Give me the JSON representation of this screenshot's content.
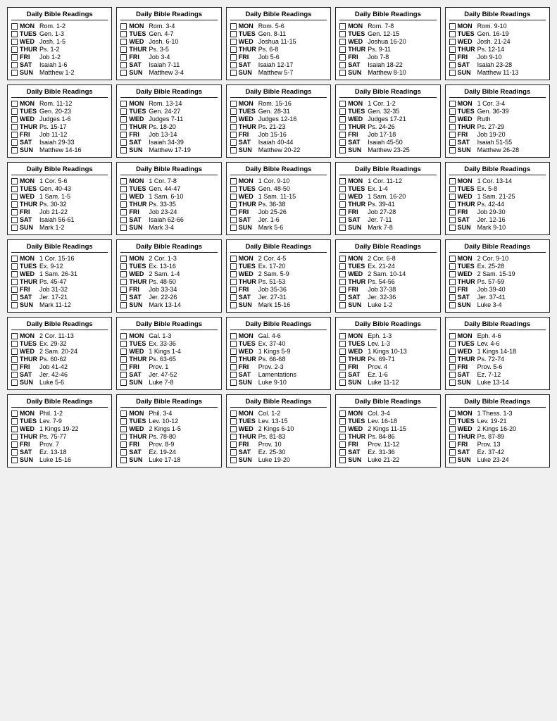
{
  "cards": [
    {
      "title": "Daily Bible Readings",
      "readings": [
        {
          "day": "MON",
          "passage": "Rom. 1-2"
        },
        {
          "day": "TUES",
          "passage": "Gen. 1-3"
        },
        {
          "day": "WED",
          "passage": "Josh. 1-5"
        },
        {
          "day": "THUR",
          "passage": "Ps. 1-2"
        },
        {
          "day": "FRI",
          "passage": "Job 1-2"
        },
        {
          "day": "SAT",
          "passage": "Isaiah 1-6"
        },
        {
          "day": "SUN",
          "passage": "Matthew 1-2"
        }
      ]
    },
    {
      "title": "Daily Bible Readings",
      "readings": [
        {
          "day": "MON",
          "passage": "Rom. 3-4"
        },
        {
          "day": "TUES",
          "passage": "Gen. 4-7"
        },
        {
          "day": "WED",
          "passage": "Josh. 6-10"
        },
        {
          "day": "THUR",
          "passage": "Ps. 3-5"
        },
        {
          "day": "FRI",
          "passage": "Job 3-4"
        },
        {
          "day": "SAT",
          "passage": "Isaiah 7-11"
        },
        {
          "day": "SUN",
          "passage": "Matthew 3-4"
        }
      ]
    },
    {
      "title": "Daily Bible Readings",
      "readings": [
        {
          "day": "MON",
          "passage": "Rom. 5-6"
        },
        {
          "day": "TUES",
          "passage": "Gen. 8-11"
        },
        {
          "day": "WED",
          "passage": "Joshua 11-15"
        },
        {
          "day": "THUR",
          "passage": "Ps. 6-8"
        },
        {
          "day": "FRI",
          "passage": "Job 5-6"
        },
        {
          "day": "SAT",
          "passage": "Isaiah 12-17"
        },
        {
          "day": "SUN",
          "passage": "Matthew 5-7"
        }
      ]
    },
    {
      "title": "Daily Bible Readings",
      "readings": [
        {
          "day": "MON",
          "passage": "Rom. 7-8"
        },
        {
          "day": "TUES",
          "passage": "Gen. 12-15"
        },
        {
          "day": "WED",
          "passage": "Joshua 16-20"
        },
        {
          "day": "THUR",
          "passage": "Ps. 9-11"
        },
        {
          "day": "FRI",
          "passage": "Job 7-8"
        },
        {
          "day": "SAT",
          "passage": "Isaiah 18-22"
        },
        {
          "day": "SUN",
          "passage": "Matthew 8-10"
        }
      ]
    },
    {
      "title": "Daily Bible Readings",
      "readings": [
        {
          "day": "MON",
          "passage": "Rom. 9-10"
        },
        {
          "day": "TUES",
          "passage": "Gen. 16-19"
        },
        {
          "day": "WED",
          "passage": "Josh. 21-24"
        },
        {
          "day": "THUR",
          "passage": "Ps. 12-14"
        },
        {
          "day": "FRI",
          "passage": "Job 9-10"
        },
        {
          "day": "SAT",
          "passage": "Isaiah 23-28"
        },
        {
          "day": "SUN",
          "passage": "Matthew 11-13"
        }
      ]
    },
    {
      "title": "Daily Bible Readings",
      "readings": [
        {
          "day": "MON",
          "passage": "Rom. 11-12"
        },
        {
          "day": "TUES",
          "passage": "Gen. 20-23"
        },
        {
          "day": "WED",
          "passage": "Judges 1-6"
        },
        {
          "day": "THUR",
          "passage": "Ps. 15-17"
        },
        {
          "day": "FRI",
          "passage": "Job 11-12"
        },
        {
          "day": "SAT",
          "passage": "Isaiah 29-33"
        },
        {
          "day": "SUN",
          "passage": "Matthew 14-16"
        }
      ]
    },
    {
      "title": "Daily Bible Readings",
      "readings": [
        {
          "day": "MON",
          "passage": "Rom. 13-14"
        },
        {
          "day": "TUES",
          "passage": "Gen. 24-27"
        },
        {
          "day": "WED",
          "passage": "Judges 7-11"
        },
        {
          "day": "THUR",
          "passage": "Ps. 18-20"
        },
        {
          "day": "FRI",
          "passage": "Job 13-14"
        },
        {
          "day": "SAT",
          "passage": "Isaiah 34-39"
        },
        {
          "day": "SUN",
          "passage": "Matthew 17-19"
        }
      ]
    },
    {
      "title": "Daily Bible Readings",
      "readings": [
        {
          "day": "MON",
          "passage": "Rom. 15-16"
        },
        {
          "day": "TUES",
          "passage": "Gen. 28-31"
        },
        {
          "day": "WED",
          "passage": "Judges 12-16"
        },
        {
          "day": "THUR",
          "passage": "Ps. 21-23"
        },
        {
          "day": "FRI",
          "passage": "Job 15-16"
        },
        {
          "day": "SAT",
          "passage": "Isaiah 40-44"
        },
        {
          "day": "SUN",
          "passage": "Matthew 20-22"
        }
      ]
    },
    {
      "title": "Daily Bible Readings",
      "readings": [
        {
          "day": "MON",
          "passage": "1 Cor. 1-2"
        },
        {
          "day": "TUES",
          "passage": "Gen. 32-35"
        },
        {
          "day": "WED",
          "passage": "Judges 17-21"
        },
        {
          "day": "THUR",
          "passage": "Ps. 24-26"
        },
        {
          "day": "FRI",
          "passage": "Job 17-18"
        },
        {
          "day": "SAT",
          "passage": "Isaiah 45-50"
        },
        {
          "day": "SUN",
          "passage": "Matthew 23-25"
        }
      ]
    },
    {
      "title": "Daily Bible Readings",
      "readings": [
        {
          "day": "MON",
          "passage": "1 Cor. 3-4"
        },
        {
          "day": "TUES",
          "passage": "Gen. 36-39"
        },
        {
          "day": "WED",
          "passage": "Ruth"
        },
        {
          "day": "THUR",
          "passage": "Ps. 27-29"
        },
        {
          "day": "FRI",
          "passage": "Job 19-20"
        },
        {
          "day": "SAT",
          "passage": "Isaiah 51-55"
        },
        {
          "day": "SUN",
          "passage": "Matthew 26-28"
        }
      ]
    },
    {
      "title": "Daily Bible Readings",
      "readings": [
        {
          "day": "MON",
          "passage": "1 Cor. 5-6"
        },
        {
          "day": "TUES",
          "passage": "Gen. 40-43"
        },
        {
          "day": "WED",
          "passage": "1 Sam. 1-5"
        },
        {
          "day": "THUR",
          "passage": "Ps. 30-32"
        },
        {
          "day": "FRI",
          "passage": "Job 21-22"
        },
        {
          "day": "SAT",
          "passage": "Isaiah 56-61"
        },
        {
          "day": "SUN",
          "passage": "Mark 1-2"
        }
      ]
    },
    {
      "title": "Daily Bible Readings",
      "readings": [
        {
          "day": "MON",
          "passage": "1 Cor. 7-8"
        },
        {
          "day": "TUES",
          "passage": "Gen. 44-47"
        },
        {
          "day": "WED",
          "passage": "1 Sam. 6-10"
        },
        {
          "day": "THUR",
          "passage": "Ps. 33-35"
        },
        {
          "day": "FRI",
          "passage": "Job 23-24"
        },
        {
          "day": "SAT",
          "passage": "Isaiah 62-66"
        },
        {
          "day": "SUN",
          "passage": "Mark 3-4"
        }
      ]
    },
    {
      "title": "Daily Bible Readings",
      "readings": [
        {
          "day": "MON",
          "passage": "1 Cor. 9-10"
        },
        {
          "day": "TUES",
          "passage": "Gen. 48-50"
        },
        {
          "day": "WED",
          "passage": "1 Sam. 11-15"
        },
        {
          "day": "THUR",
          "passage": "Ps. 36-38"
        },
        {
          "day": "FRI",
          "passage": "Job 25-26"
        },
        {
          "day": "SAT",
          "passage": "Jer. 1-6"
        },
        {
          "day": "SUN",
          "passage": "Mark 5-6"
        }
      ]
    },
    {
      "title": "Daily Bible Readings",
      "readings": [
        {
          "day": "MON",
          "passage": "1 Cor. 11-12"
        },
        {
          "day": "TUES",
          "passage": "Ex. 1-4"
        },
        {
          "day": "WED",
          "passage": "1 Sam. 16-20"
        },
        {
          "day": "THUR",
          "passage": "Ps. 39-41"
        },
        {
          "day": "FRI",
          "passage": "Job 27-28"
        },
        {
          "day": "SAT",
          "passage": "Jer. 7-11"
        },
        {
          "day": "SUN",
          "passage": "Mark 7-8"
        }
      ]
    },
    {
      "title": "Daily Bible Readings",
      "readings": [
        {
          "day": "MON",
          "passage": "1 Cor. 13-14"
        },
        {
          "day": "TUES",
          "passage": "Ex. 5-8"
        },
        {
          "day": "WED",
          "passage": "1 Sam. 21-25"
        },
        {
          "day": "THUR",
          "passage": "Ps. 42-44"
        },
        {
          "day": "FRI",
          "passage": "Job 29-30"
        },
        {
          "day": "SAT",
          "passage": "Jer. 12-16"
        },
        {
          "day": "SUN",
          "passage": "Mark 9-10"
        }
      ]
    },
    {
      "title": "Daily Bible Readings",
      "readings": [
        {
          "day": "MON",
          "passage": "1 Cor. 15-16"
        },
        {
          "day": "TUES",
          "passage": "Ex. 9-12"
        },
        {
          "day": "WED",
          "passage": "1 Sam. 26-31"
        },
        {
          "day": "THUR",
          "passage": "Ps. 45-47"
        },
        {
          "day": "FRI",
          "passage": "Job 31-32"
        },
        {
          "day": "SAT",
          "passage": "Jer. 17-21"
        },
        {
          "day": "SUN",
          "passage": "Mark 11-12"
        }
      ]
    },
    {
      "title": "Daily Bible Readings",
      "readings": [
        {
          "day": "MON",
          "passage": "2 Cor. 1-3"
        },
        {
          "day": "TUES",
          "passage": "Ex. 13-16"
        },
        {
          "day": "WED",
          "passage": "2 Sam. 1-4"
        },
        {
          "day": "THUR",
          "passage": "Ps. 48-50"
        },
        {
          "day": "FRI",
          "passage": "Job 33-34"
        },
        {
          "day": "SAT",
          "passage": "Jer. 22-26"
        },
        {
          "day": "SUN",
          "passage": "Mark 13-14"
        }
      ]
    },
    {
      "title": "Daily Bible Readings",
      "readings": [
        {
          "day": "MON",
          "passage": "2 Cor. 4-5"
        },
        {
          "day": "TUES",
          "passage": "Ex. 17-20"
        },
        {
          "day": "WED",
          "passage": "2 Sam. 5-9"
        },
        {
          "day": "THUR",
          "passage": "Ps. 51-53"
        },
        {
          "day": "FRI",
          "passage": "Job 35-36"
        },
        {
          "day": "SAT",
          "passage": "Jer. 27-31"
        },
        {
          "day": "SUN",
          "passage": "Mark 15-16"
        }
      ]
    },
    {
      "title": "Daily Bible Readings",
      "readings": [
        {
          "day": "MON",
          "passage": "2 Cor. 6-8"
        },
        {
          "day": "TUES",
          "passage": "Ex. 21-24"
        },
        {
          "day": "WED",
          "passage": "2 Sam. 10-14"
        },
        {
          "day": "THUR",
          "passage": "Ps. 54-56"
        },
        {
          "day": "FRI",
          "passage": "Job 37-38"
        },
        {
          "day": "SAT",
          "passage": "Jer. 32-36"
        },
        {
          "day": "SUN",
          "passage": "Luke 1-2"
        }
      ]
    },
    {
      "title": "Daily Bible Readings",
      "readings": [
        {
          "day": "MON",
          "passage": "2 Cor. 9-10"
        },
        {
          "day": "TUES",
          "passage": "Ex. 25-28"
        },
        {
          "day": "WED",
          "passage": "2 Sam. 15-19"
        },
        {
          "day": "THUR",
          "passage": "Ps. 57-59"
        },
        {
          "day": "FRI",
          "passage": "Job 39-40"
        },
        {
          "day": "SAT",
          "passage": "Jer. 37-41"
        },
        {
          "day": "SUN",
          "passage": "Luke 3-4"
        }
      ]
    },
    {
      "title": "Daily Bible Readings",
      "readings": [
        {
          "day": "MON",
          "passage": "2 Cor. 11-13"
        },
        {
          "day": "TUES",
          "passage": "Ex. 29-32"
        },
        {
          "day": "WED",
          "passage": "2 Sam. 20-24"
        },
        {
          "day": "THUR",
          "passage": "Ps. 60-62"
        },
        {
          "day": "FRI",
          "passage": "Job 41-42"
        },
        {
          "day": "SAT",
          "passage": "Jer. 42-46"
        },
        {
          "day": "SUN",
          "passage": "Luke 5-6"
        }
      ]
    },
    {
      "title": "Daily Bible Readings",
      "readings": [
        {
          "day": "MON",
          "passage": "Gal. 1-3"
        },
        {
          "day": "TUES",
          "passage": "Ex. 33-36"
        },
        {
          "day": "WED",
          "passage": "1 Kings 1-4"
        },
        {
          "day": "THUR",
          "passage": "Ps. 63-65"
        },
        {
          "day": "FRI",
          "passage": "Prov. 1"
        },
        {
          "day": "SAT",
          "passage": "Jer. 47-52"
        },
        {
          "day": "SUN",
          "passage": "Luke 7-8"
        }
      ]
    },
    {
      "title": "Daily Bible Readings",
      "readings": [
        {
          "day": "MON",
          "passage": "Gal. 4-6"
        },
        {
          "day": "TUES",
          "passage": "Ex. 37-40"
        },
        {
          "day": "WED",
          "passage": "1 Kings 5-9"
        },
        {
          "day": "THUR",
          "passage": "Ps. 66-68"
        },
        {
          "day": "FRI",
          "passage": "Prov. 2-3"
        },
        {
          "day": "SAT",
          "passage": "Lamentations"
        },
        {
          "day": "SUN",
          "passage": "Luke 9-10"
        }
      ]
    },
    {
      "title": "Daily Bible Readings",
      "readings": [
        {
          "day": "MON",
          "passage": "Eph. 1-3"
        },
        {
          "day": "TUES",
          "passage": "Lev. 1-3"
        },
        {
          "day": "WED",
          "passage": "1 Kings 10-13"
        },
        {
          "day": "THUR",
          "passage": "Ps. 69-71"
        },
        {
          "day": "FRI",
          "passage": "Prov. 4"
        },
        {
          "day": "SAT",
          "passage": "Ez. 1-6"
        },
        {
          "day": "SUN",
          "passage": "Luke 11-12"
        }
      ]
    },
    {
      "title": "Daily Bible Readings",
      "readings": [
        {
          "day": "MON",
          "passage": "Eph. 4-6"
        },
        {
          "day": "TUES",
          "passage": "Lev. 4-6"
        },
        {
          "day": "WED",
          "passage": "1 Kings 14-18"
        },
        {
          "day": "THUR",
          "passage": "Ps. 72-74"
        },
        {
          "day": "FRI",
          "passage": "Prov. 5-6"
        },
        {
          "day": "SAT",
          "passage": "Ez. 7-12"
        },
        {
          "day": "SUN",
          "passage": "Luke 13-14"
        }
      ]
    },
    {
      "title": "Daily Bible Readings",
      "readings": [
        {
          "day": "MON",
          "passage": "Phil. 1-2"
        },
        {
          "day": "TUES",
          "passage": "Lev. 7-9"
        },
        {
          "day": "WED",
          "passage": "1 Kings 19-22"
        },
        {
          "day": "THUR",
          "passage": "Ps. 75-77"
        },
        {
          "day": "FRI",
          "passage": "Prov. 7"
        },
        {
          "day": "SAT",
          "passage": "Ez. 13-18"
        },
        {
          "day": "SUN",
          "passage": "Luke 15-16"
        }
      ]
    },
    {
      "title": "Daily Bible Readings",
      "readings": [
        {
          "day": "MON",
          "passage": "Phil. 3-4"
        },
        {
          "day": "TUES",
          "passage": "Lev. 10-12"
        },
        {
          "day": "WED",
          "passage": "2 Kings 1-5"
        },
        {
          "day": "THUR",
          "passage": "Ps. 78-80"
        },
        {
          "day": "FRI",
          "passage": "Prov. 8-9"
        },
        {
          "day": "SAT",
          "passage": "Ez. 19-24"
        },
        {
          "day": "SUN",
          "passage": "Luke 17-18"
        }
      ]
    },
    {
      "title": "Daily Bible Readings",
      "readings": [
        {
          "day": "MON",
          "passage": "Col. 1-2"
        },
        {
          "day": "TUES",
          "passage": "Lev. 13-15"
        },
        {
          "day": "WED",
          "passage": "2 Kings 6-10"
        },
        {
          "day": "THUR",
          "passage": "Ps. 81-83"
        },
        {
          "day": "FRI",
          "passage": "Prov. 10"
        },
        {
          "day": "SAT",
          "passage": "Ez. 25-30"
        },
        {
          "day": "SUN",
          "passage": "Luke 19-20"
        }
      ]
    },
    {
      "title": "Daily Bible Readings",
      "readings": [
        {
          "day": "MON",
          "passage": "Col. 3-4"
        },
        {
          "day": "TUES",
          "passage": "Lev. 16-18"
        },
        {
          "day": "WED",
          "passage": "2 Kings 11-15"
        },
        {
          "day": "THUR",
          "passage": "Ps. 84-86"
        },
        {
          "day": "FRI",
          "passage": "Prov. 11-12"
        },
        {
          "day": "SAT",
          "passage": "Ez. 31-36"
        },
        {
          "day": "SUN",
          "passage": "Luke 21-22"
        }
      ]
    },
    {
      "title": "Daily Bible Readings",
      "readings": [
        {
          "day": "MON",
          "passage": "1 Thess. 1-3"
        },
        {
          "day": "TUES",
          "passage": "Lev. 19-21"
        },
        {
          "day": "WED",
          "passage": "2 Kings 16-20"
        },
        {
          "day": "THUR",
          "passage": "Ps. 87-89"
        },
        {
          "day": "FRI",
          "passage": "Prov. 13"
        },
        {
          "day": "SAT",
          "passage": "Ez. 37-42"
        },
        {
          "day": "SUN",
          "passage": "Luke 23-24"
        }
      ]
    }
  ]
}
